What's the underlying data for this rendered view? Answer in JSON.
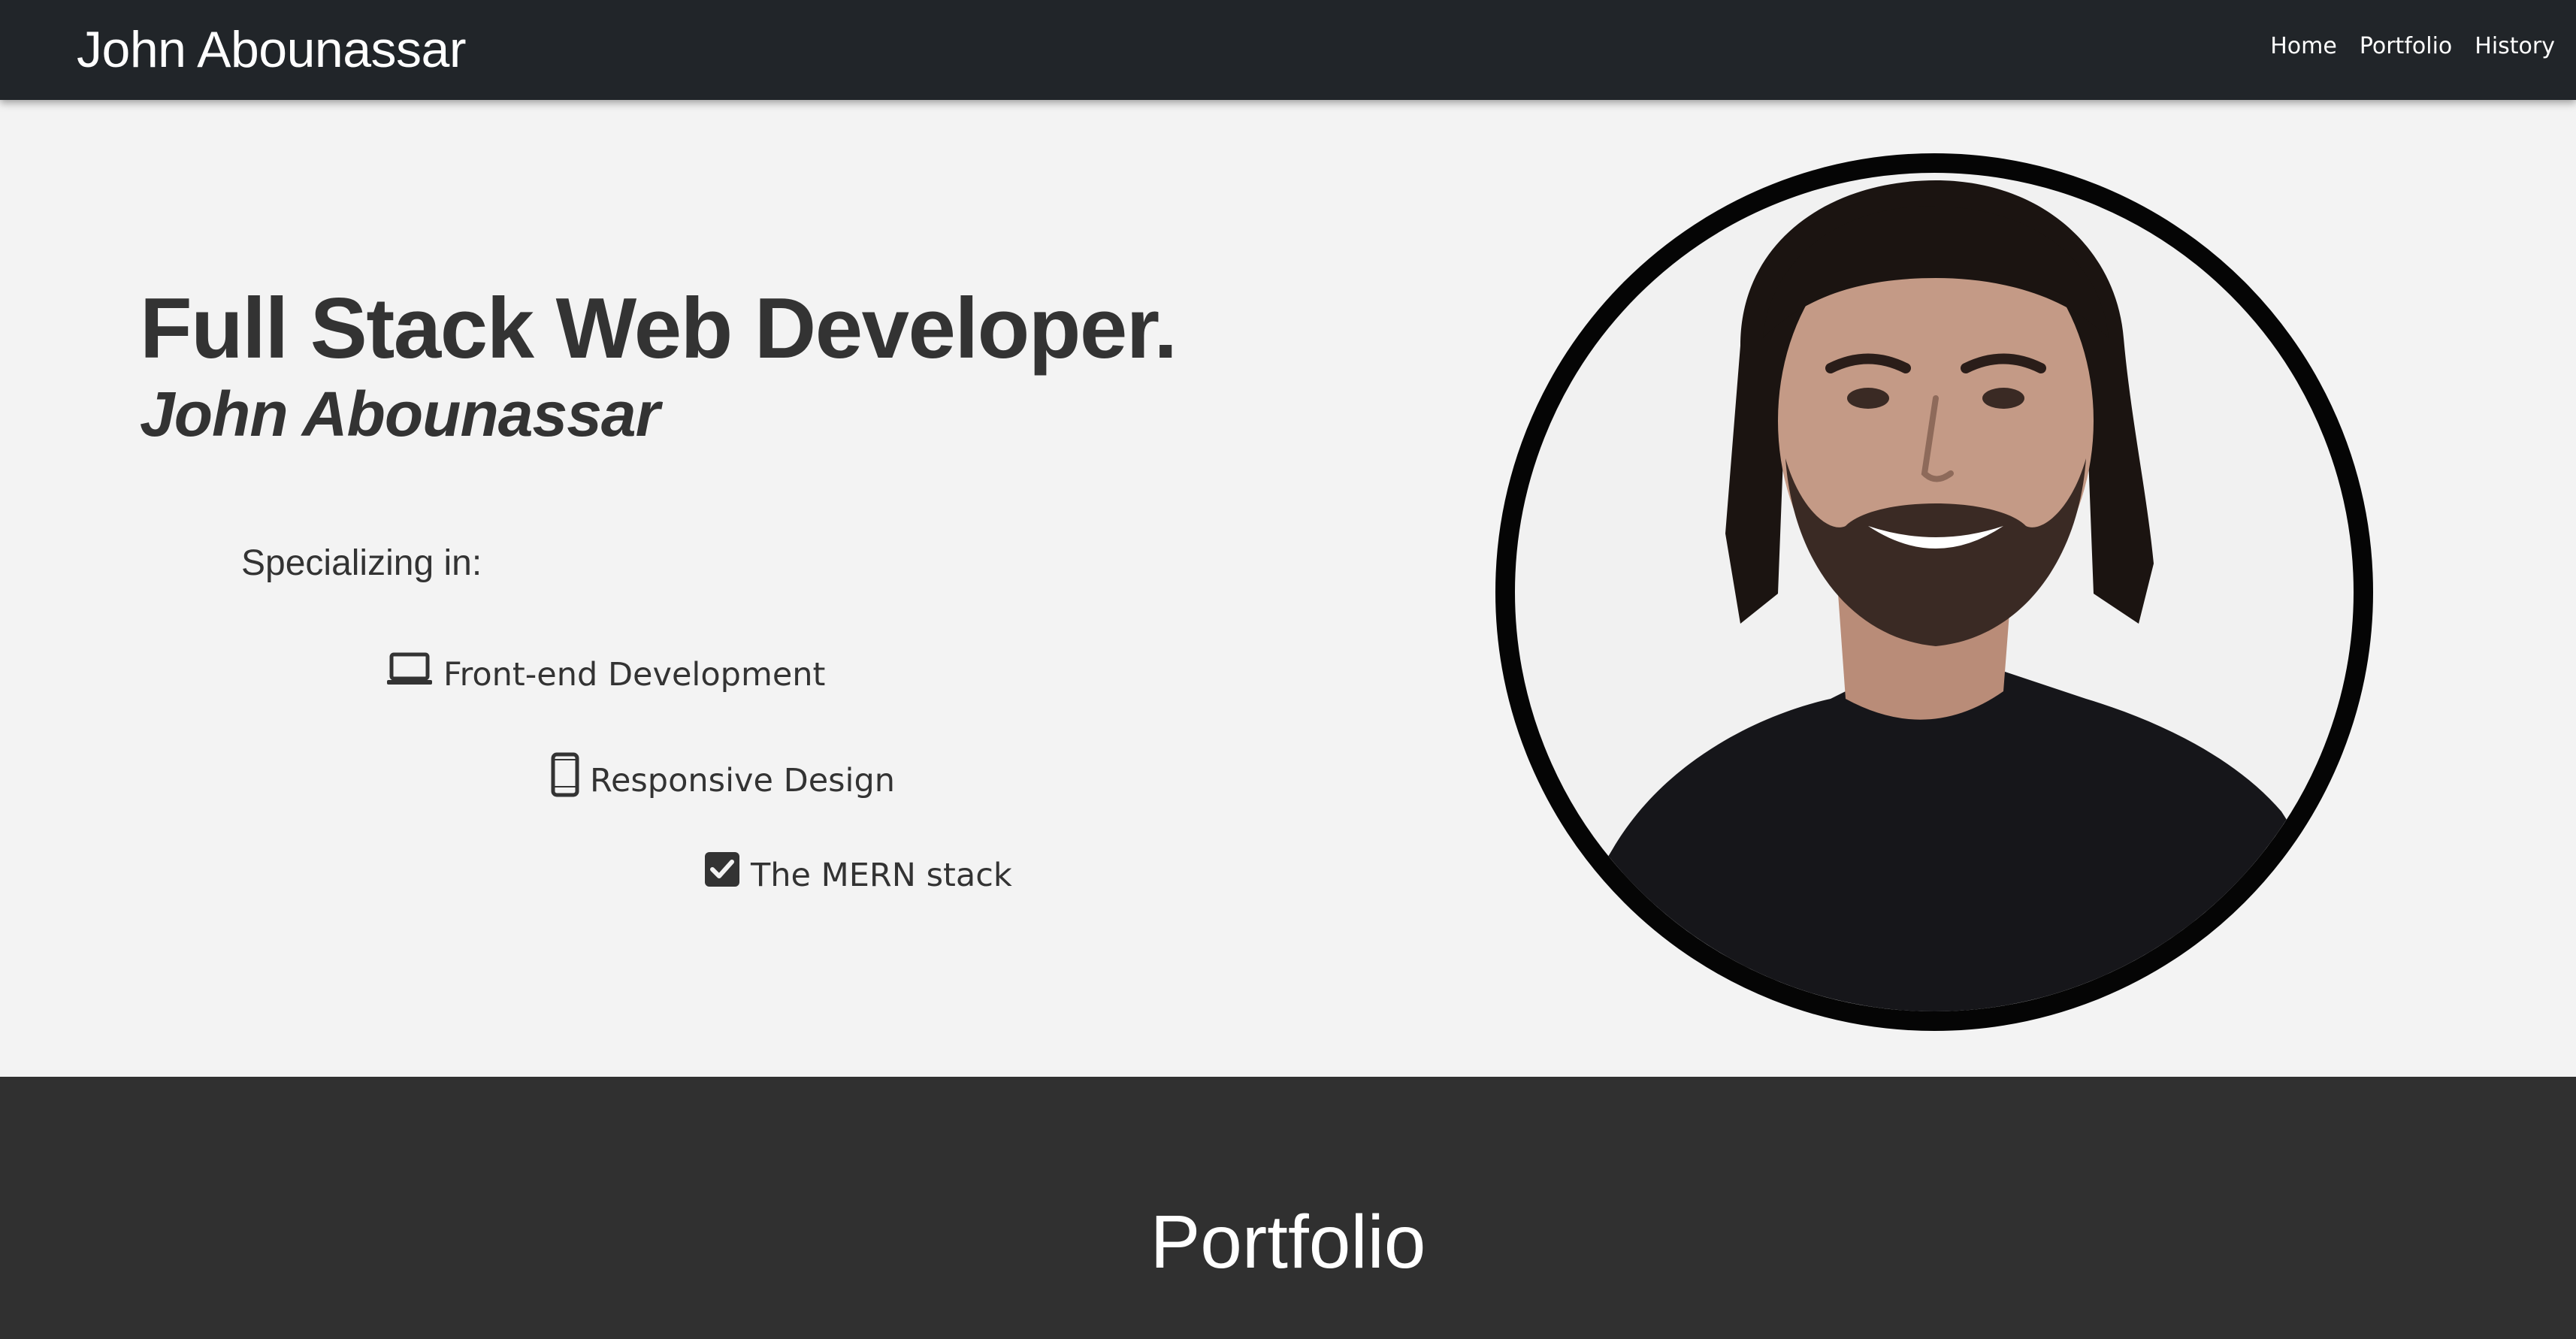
{
  "navbar": {
    "brand": "John Abounassar",
    "links": [
      "Home",
      "Portfolio",
      "History"
    ]
  },
  "hero": {
    "headline": "Full Stack Web Developer.",
    "name": "John Abounassar",
    "specializing_label": "Specializing in:",
    "specialties": [
      {
        "label": "Front-end Development",
        "icon": "laptop-icon"
      },
      {
        "label": "Responsive Design",
        "icon": "mobile-phone-icon"
      },
      {
        "label": "The MERN stack",
        "icon": "checkbox-icon"
      }
    ]
  },
  "portfolio": {
    "title": "Portfolio"
  },
  "colors": {
    "navbar_bg": "#212529",
    "hero_bg": "#f3f3f3",
    "text_dark": "#333333",
    "section_dark": "#303030",
    "portrait_border": "#050505"
  }
}
